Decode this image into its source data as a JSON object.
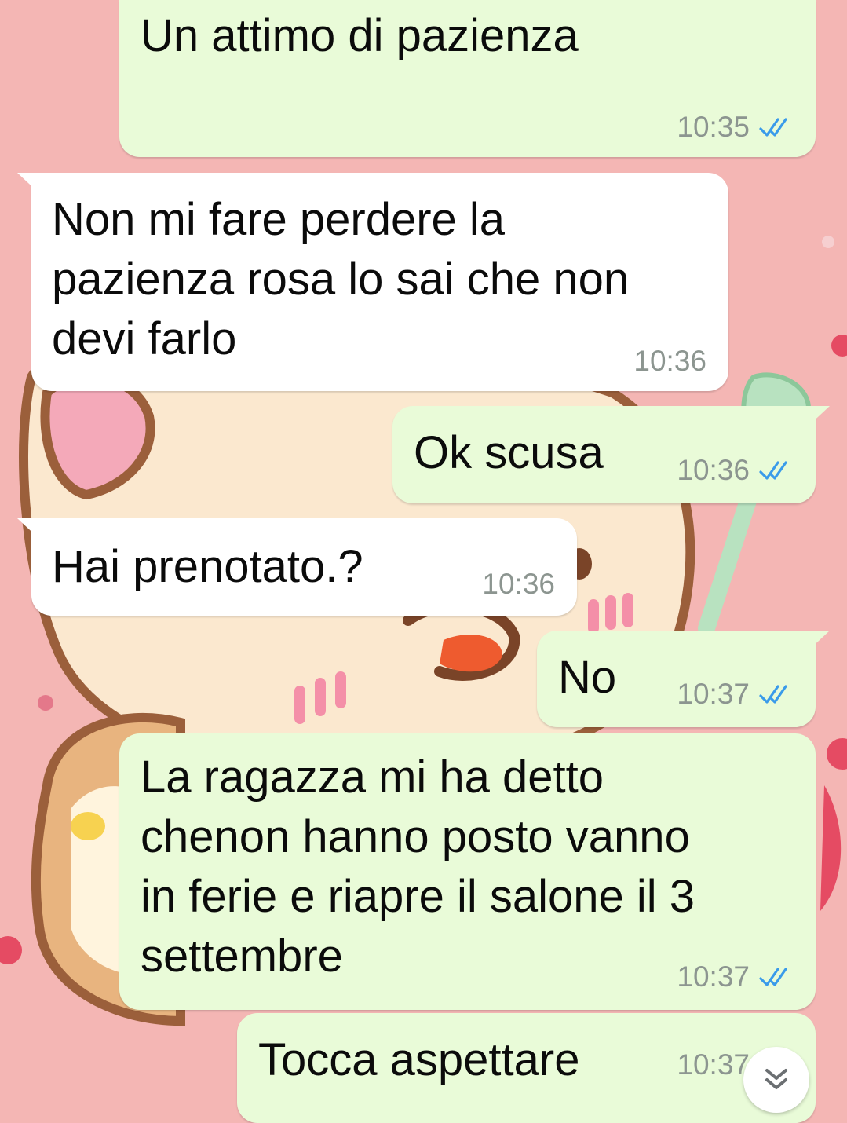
{
  "theme": {
    "wallpaper": "#f4b6b4",
    "outgoing_bubble": "#e9fbd8",
    "incoming_bubble": "#ffffff",
    "read_tick": "#3a9bea",
    "meta_text": "#8c9590"
  },
  "messages": [
    {
      "direction": "out",
      "text": "Un attimo di pazienza",
      "time": "10:35",
      "status": "read"
    },
    {
      "direction": "in",
      "text": "Non mi fare perdere la\npazienza rosa lo sai che non\ndevi farlo",
      "time": "10:36"
    },
    {
      "direction": "out",
      "text": "Ok scusa",
      "time": "10:36",
      "status": "read"
    },
    {
      "direction": "in",
      "text": "Hai prenotato.?",
      "time": "10:36"
    },
    {
      "direction": "out",
      "text": "No",
      "time": "10:37",
      "status": "read"
    },
    {
      "direction": "out",
      "text": "La ragazza mi ha detto\nchenon hanno posto vanno\nin ferie e riapre il salone il 3\nsettembre",
      "time": "10:37",
      "status": "read"
    },
    {
      "direction": "out",
      "text": "Tocca aspettare",
      "time": "10:37",
      "status": "read"
    }
  ],
  "scroll_button": {
    "icon": "double-chevron-down-icon"
  }
}
